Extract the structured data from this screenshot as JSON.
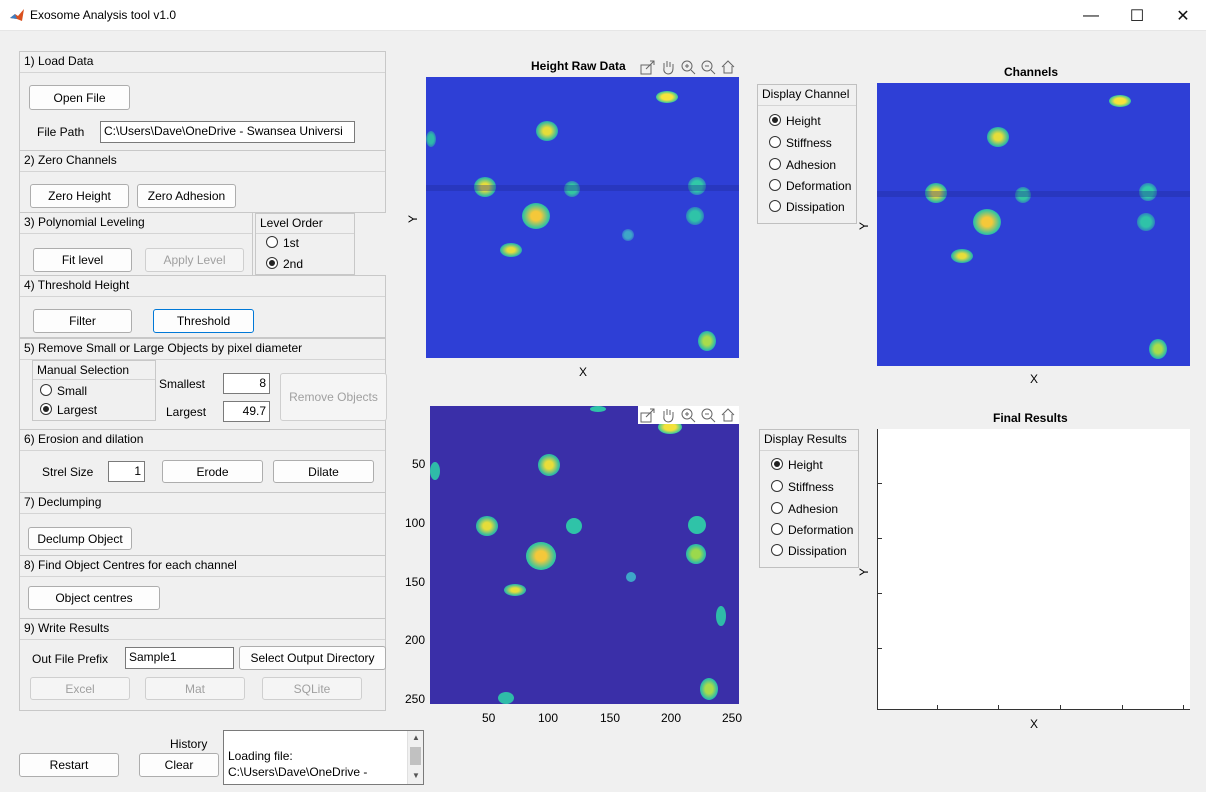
{
  "window": {
    "title": "Exosome Analysis tool v1.0"
  },
  "section1": {
    "title": "1) Load Data",
    "open_file": "Open File",
    "file_path_label": "File Path",
    "file_path_value": "C:\\Users\\Dave\\OneDrive - Swansea Universi"
  },
  "section2": {
    "title": "2) Zero Channels",
    "zero_height": "Zero Height",
    "zero_adhesion": "Zero Adhesion"
  },
  "section3": {
    "title": "3) Polynomial Leveling",
    "fit_level": "Fit level",
    "apply_level": "Apply Level",
    "level_order_title": "Level Order",
    "opt_1st": "1st",
    "opt_2nd": "2nd"
  },
  "section4": {
    "title": "4) Threshold Height",
    "filter": "Filter",
    "threshold": "Threshold"
  },
  "section5": {
    "title": "5) Remove Small or Large Objects by pixel diameter",
    "manual_selection": "Manual Selection",
    "small": "Small",
    "largest": "Largest",
    "smallest_label": "Smallest",
    "smallest_value": "8",
    "largest_label": "Largest",
    "largest_value": "49.7",
    "remove_objects": "Remove Objects"
  },
  "section6": {
    "title": "6) Erosion and dilation",
    "strel_label": "Strel Size",
    "strel_value": "1",
    "erode": "Erode",
    "dilate": "Dilate"
  },
  "section7": {
    "title": "7) Declumping",
    "declump": "Declump Object"
  },
  "section8": {
    "title": "8) Find Object Centres for each channel",
    "centres": "Object centres"
  },
  "section9": {
    "title": "9) Write Results",
    "prefix_label": "Out File Prefix",
    "prefix_value": "Sample1",
    "select_dir": "Select Output Directory",
    "excel": "Excel",
    "mat": "Mat",
    "sqlite": "SQLite"
  },
  "bottom": {
    "restart": "Restart",
    "history_label": "History",
    "clear": "Clear",
    "history_lines": [
      "Loading file:",
      "C:\\Users\\Dave\\OneDrive -"
    ]
  },
  "raw_plot": {
    "title": "Height Raw Data",
    "xlabel": "X",
    "ylabel": "Y"
  },
  "threshold_plot": {
    "xticks": [
      "50",
      "100",
      "150",
      "200",
      "250"
    ],
    "yticks": [
      "50",
      "100",
      "150",
      "200",
      "250"
    ]
  },
  "display_channel": {
    "title": "Display Channel",
    "options": [
      "Height",
      "Stiffness",
      "Adhesion",
      "Deformation",
      "Dissipation"
    ],
    "selected": "Height"
  },
  "channels_plot": {
    "title": "Channels",
    "xlabel": "X",
    "ylabel": "Y"
  },
  "display_results": {
    "title": "Display Results",
    "options": [
      "Height",
      "Stiffness",
      "Adhesion",
      "Deformation",
      "Dissipation"
    ],
    "selected": "Height"
  },
  "results_plot": {
    "title": "Final Results",
    "xlabel": "X",
    "ylabel": "Y"
  },
  "colors": {
    "colormap_low": "#2e3fd6",
    "threshold_bg": "#3a2fa8",
    "blob_high": "#f5e13a",
    "blob_mid": "#2fc3a8",
    "accent_focus": "#0078d7"
  }
}
